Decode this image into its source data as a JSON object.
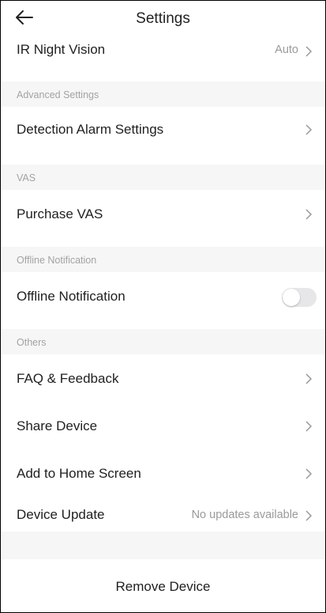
{
  "header": {
    "title": "Settings",
    "back_icon": "arrow-left-icon"
  },
  "ir_night_vision": {
    "label": "IR Night Vision",
    "value": "Auto"
  },
  "sections": {
    "advanced": "Advanced Settings",
    "vas": "VAS",
    "offline": "Offline Notification",
    "others": "Others"
  },
  "detection_alarm": {
    "label": "Detection Alarm Settings"
  },
  "purchase_vas": {
    "label": "Purchase VAS"
  },
  "offline_notification": {
    "label": "Offline Notification",
    "enabled": false
  },
  "faq": {
    "label": "FAQ & Feedback"
  },
  "share_device": {
    "label": "Share Device"
  },
  "add_home": {
    "label": "Add to Home Screen"
  },
  "device_update": {
    "label": "Device Update",
    "value": "No updates available"
  },
  "remove_device": {
    "label": "Remove Device"
  },
  "colors": {
    "section_bg": "#f6f6f7",
    "toggle_off": "#e7e7e9",
    "muted_text": "#9a9a9a"
  }
}
